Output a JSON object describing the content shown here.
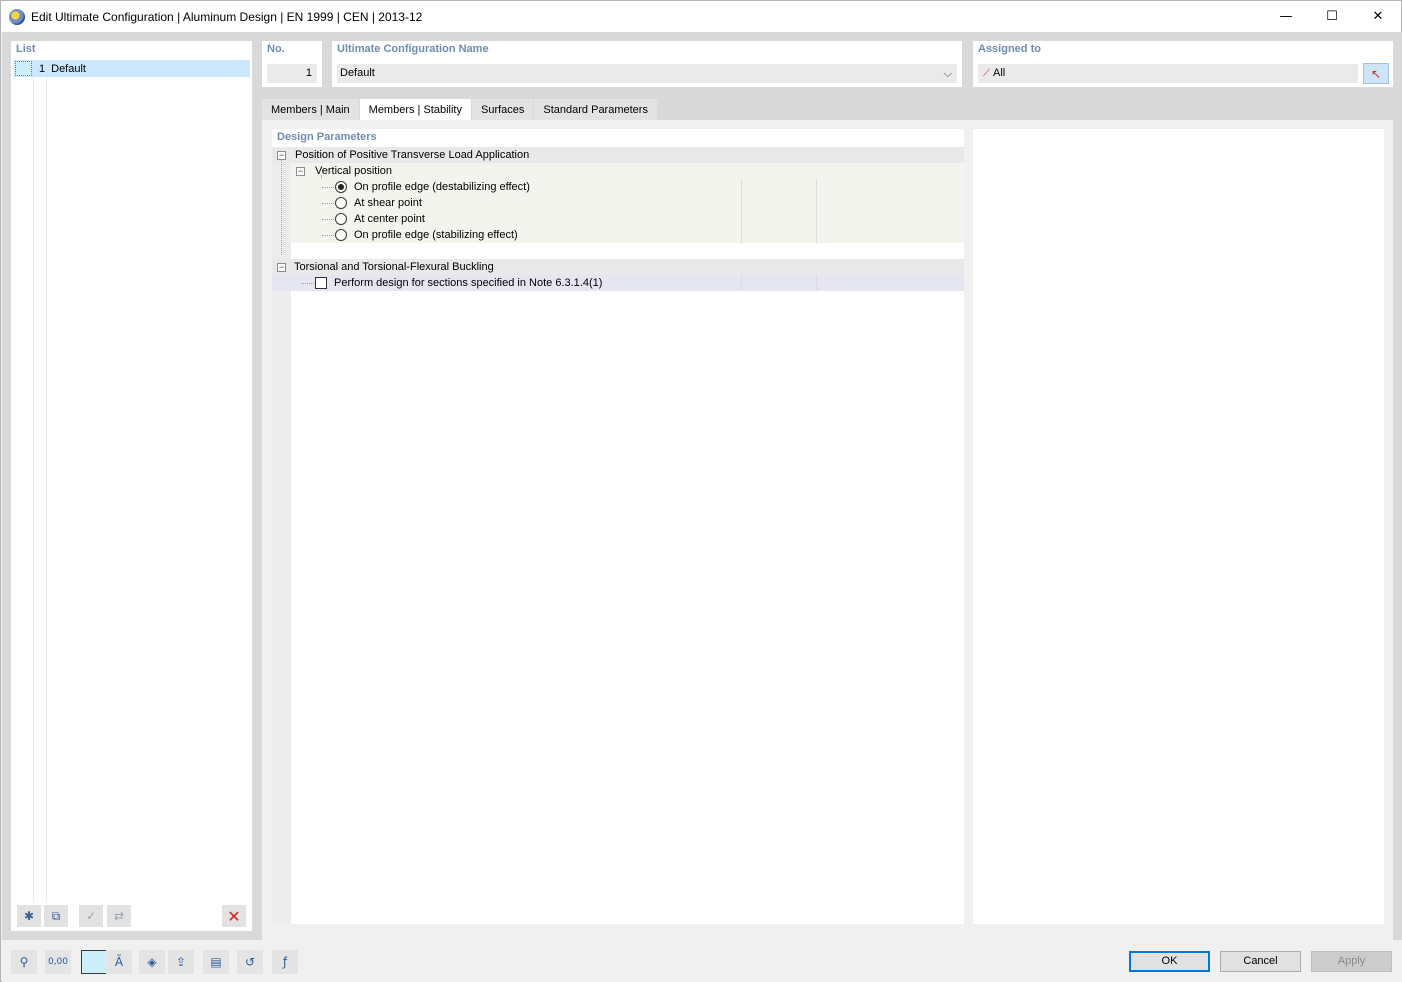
{
  "window": {
    "title": "Edit Ultimate Configuration | Aluminum Design | EN 1999 | CEN | 2013-12",
    "controls": {
      "minimize": "—",
      "maximize": "☐",
      "close": "✕"
    }
  },
  "list": {
    "label": "List",
    "items": [
      {
        "number": "1",
        "name": "Default",
        "color": "#cdeefb"
      }
    ]
  },
  "header": {
    "no_label": "No.",
    "no_value": "1",
    "name_label": "Ultimate Configuration Name",
    "name_value": "Default",
    "assigned_label": "Assigned to",
    "assigned_value": "All"
  },
  "tabs": [
    {
      "label": "Members | Main",
      "active": false
    },
    {
      "label": "Members | Stability",
      "active": true
    },
    {
      "label": "Surfaces",
      "active": false
    },
    {
      "label": "Standard Parameters",
      "active": false
    }
  ],
  "design_parameters": {
    "label": "Design Parameters",
    "group1": {
      "title": "Position of Positive Transverse Load Application",
      "sub_title": "Vertical position",
      "options": [
        {
          "label": "On profile edge (destabilizing effect)",
          "selected": true
        },
        {
          "label": "At shear point",
          "selected": false
        },
        {
          "label": "At center point",
          "selected": false
        },
        {
          "label": "On profile edge (stabilizing effect)",
          "selected": false
        }
      ]
    },
    "group2": {
      "title": "Torsional and Torsional-Flexural Buckling",
      "checkbox_label": "Perform design for sections specified in Note 6.3.1.4(1)",
      "checked": false
    }
  },
  "buttons": {
    "ok": "OK",
    "cancel": "Cancel",
    "apply": "Apply"
  },
  "icons": {
    "list_toolbar": [
      "new-item-icon",
      "copy-item-icon",
      "check-all-icon",
      "uncheck-all-icon",
      "delete-icon"
    ],
    "bottom_toolbar": [
      "help-icon",
      "units-icon",
      "color-icon",
      "section-icon",
      "model-icon",
      "export-icon",
      "library-icon",
      "reset-icon",
      "formula-icon"
    ]
  },
  "colors": {
    "label_accent": "#6e8bb5",
    "selection": "#cce8ff",
    "delete_red": "#d91d1d"
  }
}
